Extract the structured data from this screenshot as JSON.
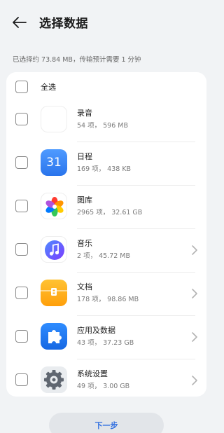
{
  "header": {
    "title": "选择数据",
    "back_icon": "arrow-left-icon"
  },
  "summary": "已选择约 73.84 MB，传输预计需要 1 分钟",
  "select_all": {
    "label": "全选",
    "checked": false
  },
  "items": [
    {
      "name": "录音",
      "meta": "54 项， 596 MB",
      "icon": "recorder-icon",
      "checked": false,
      "has_chevron": false
    },
    {
      "name": "日程",
      "meta": "169 项， 438 KB",
      "icon": "calendar-icon",
      "icon_text": "31",
      "checked": false,
      "has_chevron": false
    },
    {
      "name": "图库",
      "meta": "2965 项， 32.61 GB",
      "icon": "gallery-icon",
      "checked": false,
      "has_chevron": false
    },
    {
      "name": "音乐",
      "meta": "2 项， 45.72 MB",
      "icon": "music-icon",
      "checked": false,
      "has_chevron": true
    },
    {
      "name": "文档",
      "meta": "178 项， 98.86 MB",
      "icon": "files-icon",
      "checked": false,
      "has_chevron": true
    },
    {
      "name": "应用及数据",
      "meta": "43 项， 37.23 GB",
      "icon": "apps-icon",
      "checked": false,
      "has_chevron": true
    },
    {
      "name": "系统设置",
      "meta": "49 项， 3.00 GB",
      "icon": "settings-icon",
      "checked": false,
      "has_chevron": true
    }
  ],
  "footer": {
    "next_label": "下一步"
  },
  "colors": {
    "accent": "#2f6ee0",
    "background": "#f1f3f5",
    "card": "#ffffff"
  }
}
